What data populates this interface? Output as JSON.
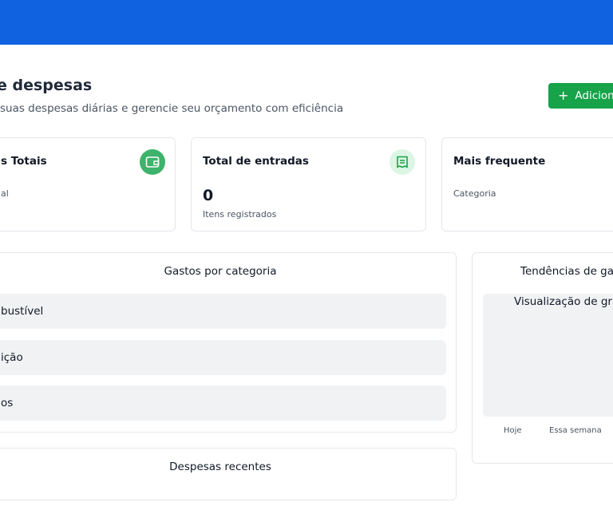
{
  "header": {
    "title": "e despesas",
    "subtitle": "suas despesas diárias e gerencie seu orçamento com eficiência",
    "add_button_label": "Adicion"
  },
  "stats": [
    {
      "title": "s Totais",
      "value": "",
      "caption": "al",
      "icon": "wallet-icon"
    },
    {
      "title": "Total de entradas",
      "value": "0",
      "caption": "Itens registrados",
      "icon": "receipt-icon"
    },
    {
      "title": "Mais frequente",
      "value": "",
      "caption": "Categoria",
      "icon": ""
    }
  ],
  "categories": {
    "title": "Gastos por categoria",
    "items": [
      "bustível",
      "ição",
      "os"
    ]
  },
  "trends": {
    "title": "Tendências de gas",
    "placeholder": "Visualização de gráf",
    "periods": [
      "Hoje",
      "Essa semana"
    ]
  },
  "recent": {
    "title": "Despesas recentes"
  },
  "colors": {
    "topbar": "#1062e0",
    "accent_green": "#16a34a",
    "icon_green_solid": "#3db36b",
    "icon_green_light": "#dcf5e4"
  }
}
